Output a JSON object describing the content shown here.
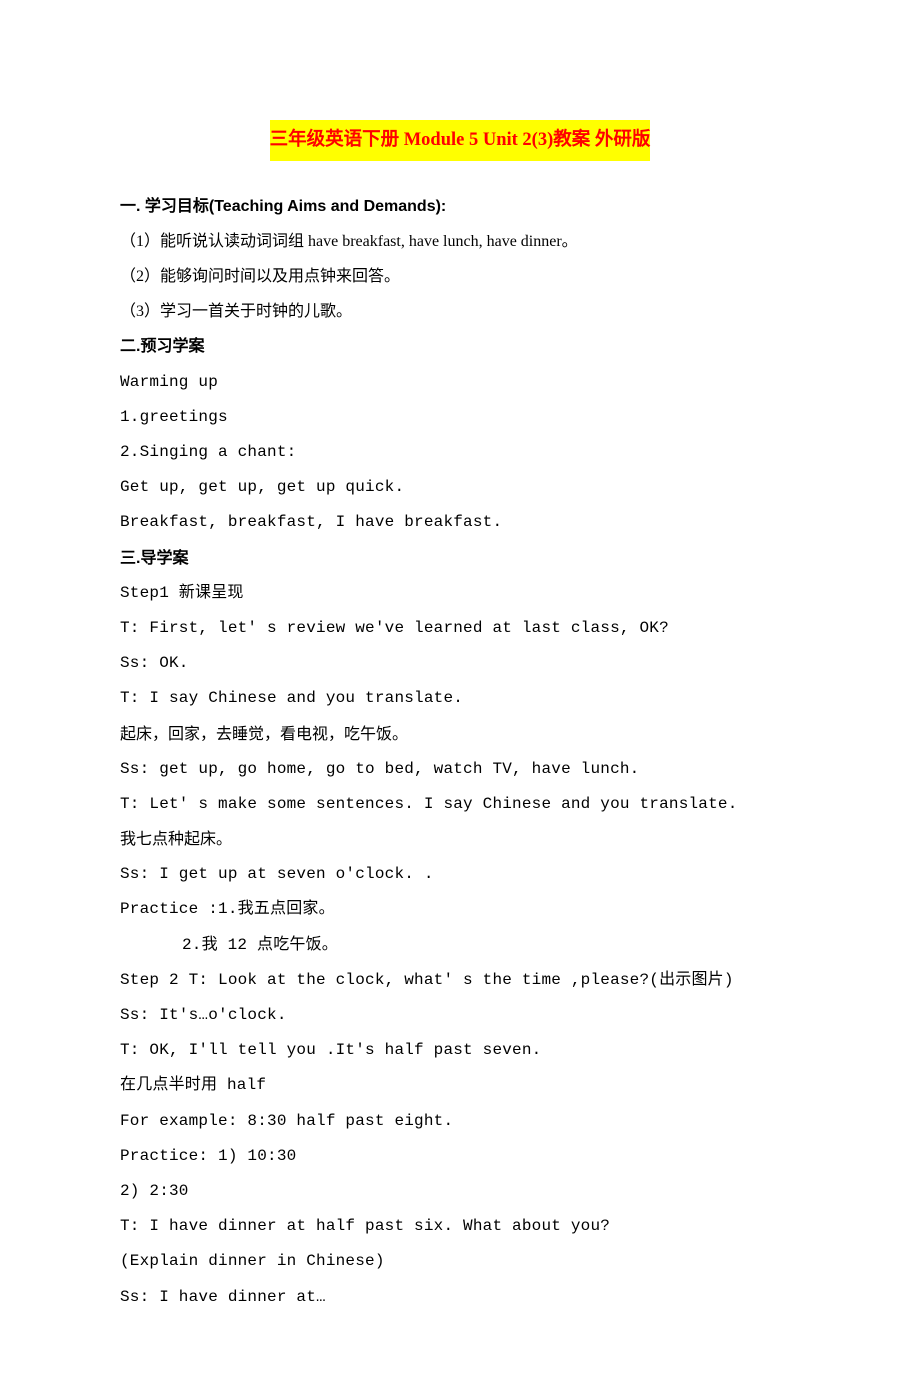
{
  "title": "三年级英语下册 Module 5 Unit 2(3)教案 外研版",
  "section1": {
    "heading": "一. 学习目标(Teaching Aims and Demands):",
    "items": [
      "（1）能听说认读动词词组 have breakfast, have lunch, have dinner。",
      "（2）能够询问时间以及用点钟来回答。",
      "（3）学习一首关于时钟的儿歌。"
    ]
  },
  "section2": {
    "heading": "二.预习学案",
    "lines": [
      "Warming up",
      "1.greetings",
      "2.Singing a chant:",
      "Get up, get up, get up quick.",
      "Breakfast, breakfast, I have breakfast."
    ]
  },
  "section3": {
    "heading": "三.导学案",
    "lines": [
      "Step1 新课呈现",
      "T: First, let' s review we've learned at last class, OK?",
      "Ss: OK.",
      "T: I say Chinese and you translate.",
      "起床，回家，去睡觉，看电视，吃午饭。",
      "Ss: get up, go home, go to bed, watch TV, have lunch.",
      "T: Let' s make some sentences. I say Chinese and you translate.",
      "我七点种起床。",
      "Ss: I get up at seven o'clock. .",
      "Practice :1.我五点回家。"
    ],
    "indented": "2.我 12 点吃午饭。",
    "lines2": [
      "Step 2 T: Look at the clock, what' s the time ,please?(出示图片)",
      "Ss: It's…o'clock.",
      "T: OK, I'll tell you .It's half past seven.",
      "在几点半时用 half",
      "For example: 8:30 half past eight.",
      "Practice: 1) 10:30",
      "2) 2:30",
      "T: I have dinner at half past six. What about you?",
      " (Explain dinner in Chinese)",
      "Ss: I have dinner at…"
    ]
  }
}
